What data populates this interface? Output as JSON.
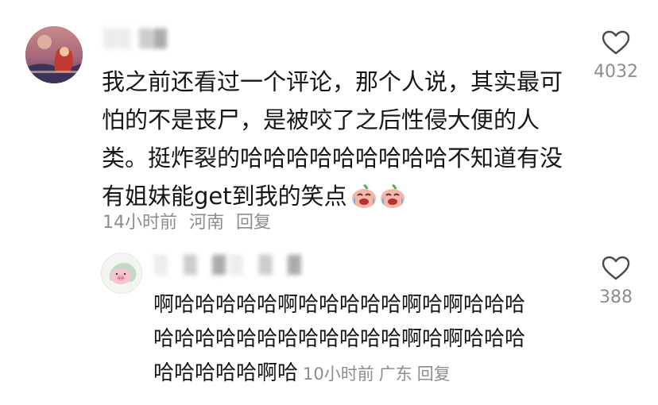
{
  "comment": {
    "username": "░░ ▒▓",
    "text_lines": [
      "我之前还看过一个评论，那个人说，其实最可",
      "怕的不是丧尸，是被咬了之后性侵大便的人",
      "类。挺炸裂的哈哈哈哈哈哈哈哈哈不知道有没",
      "有姐妹能get到我的笑点"
    ],
    "emojis": [
      "crying-laughing-emoji",
      "crying-laughing-emoji"
    ],
    "time": "14小时前",
    "location": "河南",
    "reply_label": "回复",
    "likes": "4032"
  },
  "reply": {
    "username": "░ ▒ ▓░ ▒ ▓",
    "text_lines": [
      "啊哈哈哈哈哈啊哈哈哈哈哈啊哈啊哈哈哈",
      "哈哈哈哈哈哈哈哈哈哈哈哈啊哈啊哈哈哈",
      "哈哈哈哈哈啊哈"
    ],
    "time": "10小时前",
    "location": "广东",
    "reply_label": "回复",
    "likes": "388"
  }
}
